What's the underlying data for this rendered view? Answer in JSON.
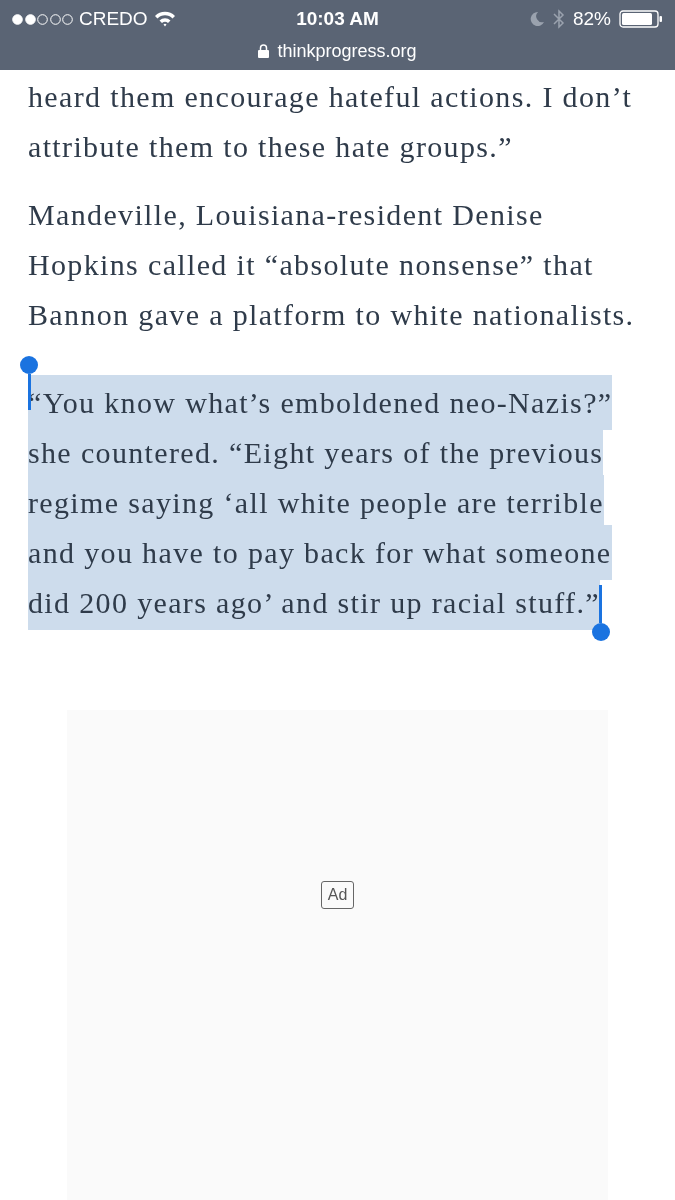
{
  "status_bar": {
    "signal_dots": [
      {
        "on": true
      },
      {
        "on": true
      },
      {
        "on": false
      },
      {
        "on": false
      },
      {
        "on": false
      }
    ],
    "carrier": "CREDO",
    "time": "10:03 AM",
    "do_not_disturb": true,
    "battery": "82%",
    "url": "thinkprogress.org"
  },
  "paragraphs": [
    {
      "text": "heard them encourage hateful actions. I don’t attribute them to these hate groups.”",
      "selected": false
    },
    {
      "text": "Mandeville, Louisiana-resident Denise Hopkins called it “absolute nonsense” that Bannon gave a platform to white nationalists.",
      "selected": false
    },
    {
      "text": "“You know what’s emboldened neo-Nazis?” she countered. “Eight years of the previous regime saying ‘all white people are terrible and you have to pay back for what someone did 200 years ago’ and stir up racial stuff.”",
      "selected": true
    }
  ],
  "ad": {
    "label": "Ad"
  }
}
